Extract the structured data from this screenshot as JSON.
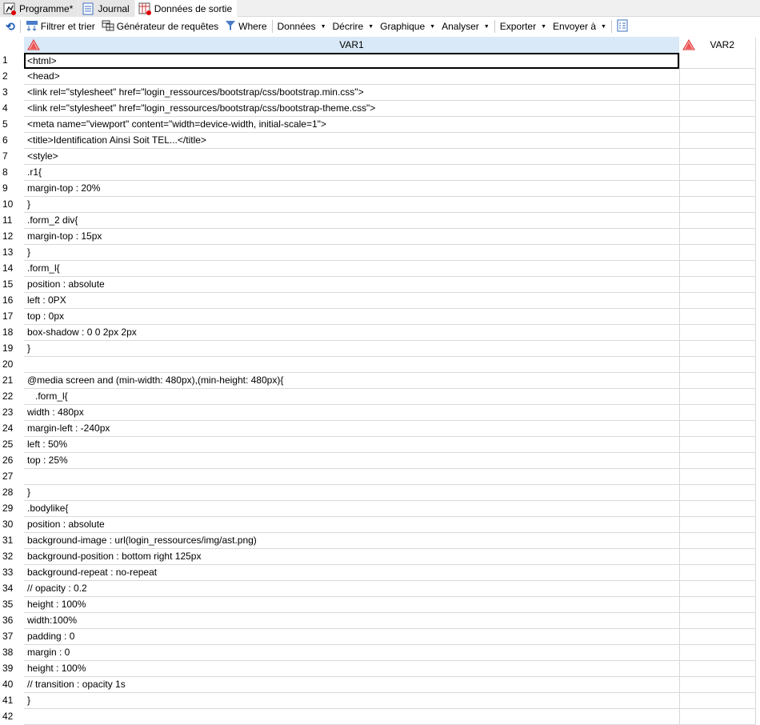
{
  "tabs": [
    {
      "label": "Programme*",
      "icon": "program-run-icon"
    },
    {
      "label": "Journal",
      "icon": "log-icon"
    },
    {
      "label": "Données de sortie",
      "icon": "output-data-icon",
      "active": true
    }
  ],
  "toolbar": {
    "filter": "Filtrer et trier",
    "query": "Générateur de requêtes",
    "where": "Where",
    "data": "Données",
    "describe": "Décrire",
    "graph": "Graphique",
    "analyze": "Analyser",
    "export": "Exporter",
    "send": "Envoyer à"
  },
  "columns": [
    "VAR1",
    "VAR2"
  ],
  "rows": [
    "<html>",
    "<head>",
    "<link rel=\"stylesheet\" href=\"login_ressources/bootstrap/css/bootstrap.min.css\">",
    "<link rel=\"stylesheet\" href=\"login_ressources/bootstrap/css/bootstrap-theme.css\">",
    "<meta name=\"viewport\" content=\"width=device-width, initial-scale=1\">",
    "<title>Identification Ainsi Soit TEL...</title>",
    "<style>",
    ".r1{",
    "margin-top : 20%",
    "}",
    ".form_2 div{",
    "margin-top : 15px",
    "}",
    ".form_l{",
    "position : absolute",
    "left : 0PX",
    "top : 0px",
    "box-shadow : 0 0 2px 2px",
    "}",
    "",
    "@media screen and (min-width: 480px),(min-height: 480px){",
    "   .form_l{",
    "width : 480px",
    "margin-left : -240px",
    "left : 50%",
    "top : 25%",
    "",
    "}",
    ".bodylike{",
    "position : absolute",
    "background-image : url(login_ressources/img/ast.png)",
    "background-position : bottom right 125px",
    "background-repeat : no-repeat",
    "// opacity : 0.2",
    "height : 100%",
    "width:100%",
    "padding : 0",
    "margin : 0",
    "height : 100%",
    "// transition : opacity 1s",
    "}",
    ""
  ]
}
